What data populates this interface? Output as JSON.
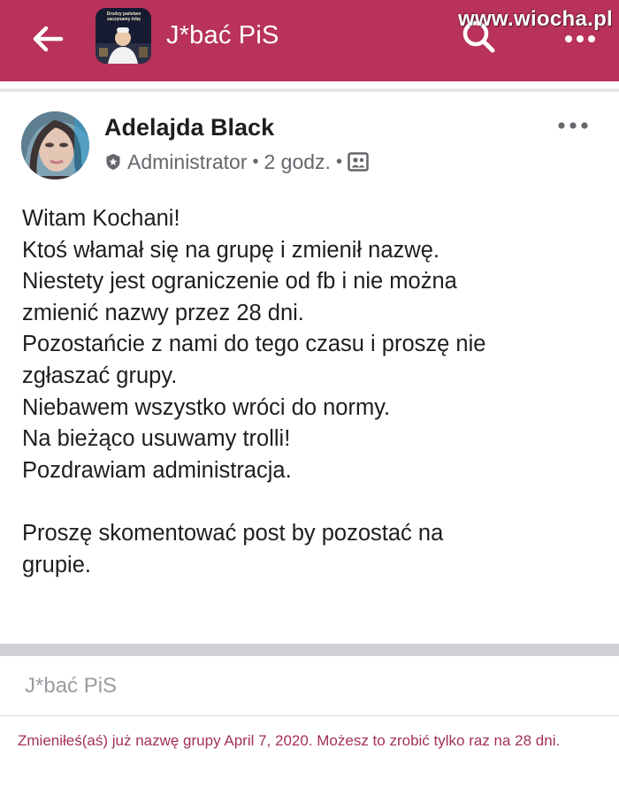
{
  "header": {
    "group_title": "J*bać PiS",
    "thumb_caption": "Drodzy państwo zaczynamy inbę",
    "watermark": "www.wiocha.pl",
    "colors": {
      "bar": "#b8325a",
      "text": "#ffffff"
    }
  },
  "post": {
    "author": "Adelajda Black",
    "role": "Administrator",
    "time": "2 godz.",
    "separator": "•",
    "lines": [
      "Witam Kochani!",
      "Ktoś włamał się na grupę i zmienił nazwę.",
      "Niestety jest ograniczenie od fb i nie można",
      "zmienić nazwy przez 28 dni.",
      "Pozostańcie z nami do tego czasu i proszę nie",
      "zgłaszać grupy.",
      "Niebawem wszystko wróci do normy.",
      "Na bieżąco usuwamy trolli!",
      "Pozdrawiam administracja.",
      "",
      "Proszę skomentować post by pozostać na",
      "grupie."
    ]
  },
  "rename": {
    "group_name_value": "J*bać PiS",
    "notice": "Zmieniłeś(aś) już nazwę grupy April 7, 2020. Możesz to zrobić tylko raz na 28 dni."
  }
}
